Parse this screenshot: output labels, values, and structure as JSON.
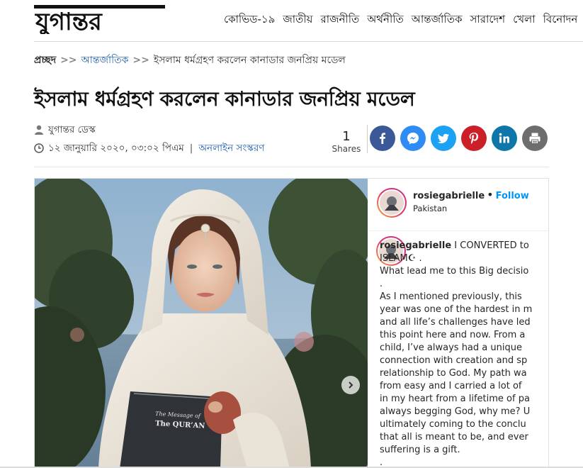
{
  "site": {
    "logo_text": "যুগান্তর",
    "nav": [
      "কোভিড-১৯",
      "জাতীয়",
      "রাজনীতি",
      "অর্থনীতি",
      "আন্তর্জাতিক",
      "সারাদেশ",
      "খেলা",
      "বিনোদন"
    ]
  },
  "breadcrumb": {
    "home": "প্রচ্ছদ",
    "separator": ">>",
    "section": "আন্তর্জাতিক",
    "current": "ইসলাম ধর্মগ্রহণ করলেন কানাডার জনপ্রিয় মডেল"
  },
  "article": {
    "title": "ইসলাম ধর্মগ্রহণ করলেন কানাডার জনপ্রিয় মডেল",
    "author": "যুগান্তর ডেস্ক",
    "date": "১২ জানুয়ারি ২০২০, ০৩:০২ পিএম",
    "divider": "|",
    "edition": "অনলাইন সংস্করণ"
  },
  "shares": {
    "count": "1",
    "label": "Shares"
  },
  "social": [
    {
      "name": "facebook",
      "color": "#3b5998"
    },
    {
      "name": "messenger",
      "color": "#2f8cf5"
    },
    {
      "name": "twitter",
      "color": "#1da1f2"
    },
    {
      "name": "pinterest",
      "color": "#cb2027"
    },
    {
      "name": "linkedin",
      "color": "#0e76a8"
    },
    {
      "name": "print",
      "color": "#6d6d6d"
    }
  ],
  "instagram": {
    "username": "rosiegabrielle",
    "follow_separator": "•",
    "follow": "Follow",
    "location": "Pakistan",
    "caption_user": "rosiegabrielle",
    "caption_lines": [
      "I CONVERTED to",
      "ISLAM☪ .",
      "What lead me to this Big decisio",
      ".",
      "As I mentioned previously, this",
      "year was one of the hardest in m",
      "and all life’s challenges have led",
      "this point here and now. From a",
      "child, I’ve always had a unique",
      "connection with creation and sp",
      "relationship to God. My path wa",
      "from easy and I carried a lot of",
      "in my heart from a lifetime of pa",
      "always begging God, why me? U",
      "ultimately coming to the conclu",
      "that all is meant to be, and ever",
      "suffering is a gift.",
      "."
    ],
    "book_line1": "The Message of",
    "book_line2": "The QUR’AN"
  }
}
